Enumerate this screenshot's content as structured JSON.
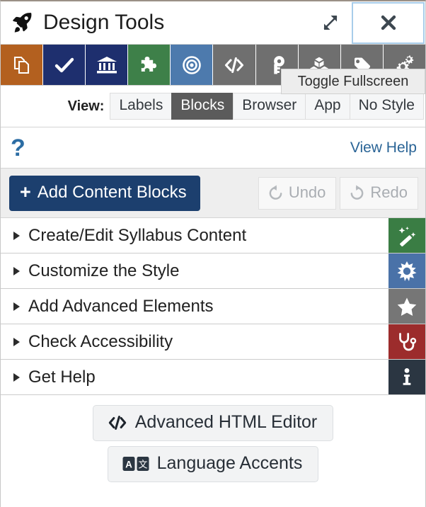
{
  "window": {
    "title": "Design Tools",
    "logo_icon": "rocket-icon",
    "expand_icon": "expand-arrows-icon",
    "close_icon": "close-icon",
    "tooltip": "Toggle Fullscreen"
  },
  "toolbar": {
    "items": [
      {
        "name": "copy-files-icon",
        "icon": "copy-files-icon",
        "color": "#b3601f"
      },
      {
        "name": "checkmark-icon",
        "icon": "checkmark-icon",
        "color": "#1e2f6e"
      },
      {
        "name": "institution-icon",
        "icon": "institution-icon",
        "color": "#1e2f6e"
      },
      {
        "name": "puzzle-piece-icon",
        "icon": "puzzle-piece-icon",
        "color": "#3e8049"
      },
      {
        "name": "bullseye-icon",
        "icon": "bullseye-icon",
        "color": "#4d7aad"
      },
      {
        "name": "code-brackets-icon",
        "icon": "code-brackets-icon",
        "color": "#6f6f6f"
      },
      {
        "name": "key-icon",
        "icon": "key-icon",
        "color": "#6f6f6f"
      },
      {
        "name": "cubes-icon",
        "icon": "cubes-icon",
        "color": "#6f6f6f"
      },
      {
        "name": "tag-icon",
        "icon": "tag-icon",
        "color": "#6f6f6f"
      },
      {
        "name": "gears-icon",
        "icon": "gears-icon",
        "color": "#6f6f6f"
      }
    ]
  },
  "view_bar": {
    "label": "View:",
    "options": [
      {
        "label": "Labels",
        "active": false
      },
      {
        "label": "Blocks",
        "active": true
      },
      {
        "label": "Browser",
        "active": false
      },
      {
        "label": "App",
        "active": false
      },
      {
        "label": "No Style",
        "active": false
      }
    ],
    "selected": "Blocks"
  },
  "help_bar": {
    "question_glyph": "?",
    "link_label": "View Help"
  },
  "actions": {
    "add_blocks_label": "Add Content Blocks",
    "add_blocks_plus": "+",
    "undo_label": "Undo",
    "redo_label": "Redo"
  },
  "accordion": {
    "rows": [
      {
        "label": "Create/Edit Syllabus Content",
        "icon": "magic-wand-icon",
        "color": "#3a7d44"
      },
      {
        "label": "Customize the Style",
        "icon": "sun-gear-icon",
        "color": "#4a72a8"
      },
      {
        "label": "Add Advanced Elements",
        "icon": "star-icon",
        "color": "#767676"
      },
      {
        "label": "Check Accessibility",
        "icon": "stethoscope-icon",
        "color": "#9c2c2c"
      },
      {
        "label": "Get Help",
        "icon": "info-icon",
        "color": "#2b3642"
      }
    ]
  },
  "footer": {
    "html_editor_label": "Advanced HTML Editor",
    "language_accents_label": "Language Accents"
  },
  "colors": {
    "primary": "#1c3f6e",
    "link": "#2a6496",
    "active_tab": "#5b5b5b",
    "focus_ring": "#a8cdea"
  }
}
